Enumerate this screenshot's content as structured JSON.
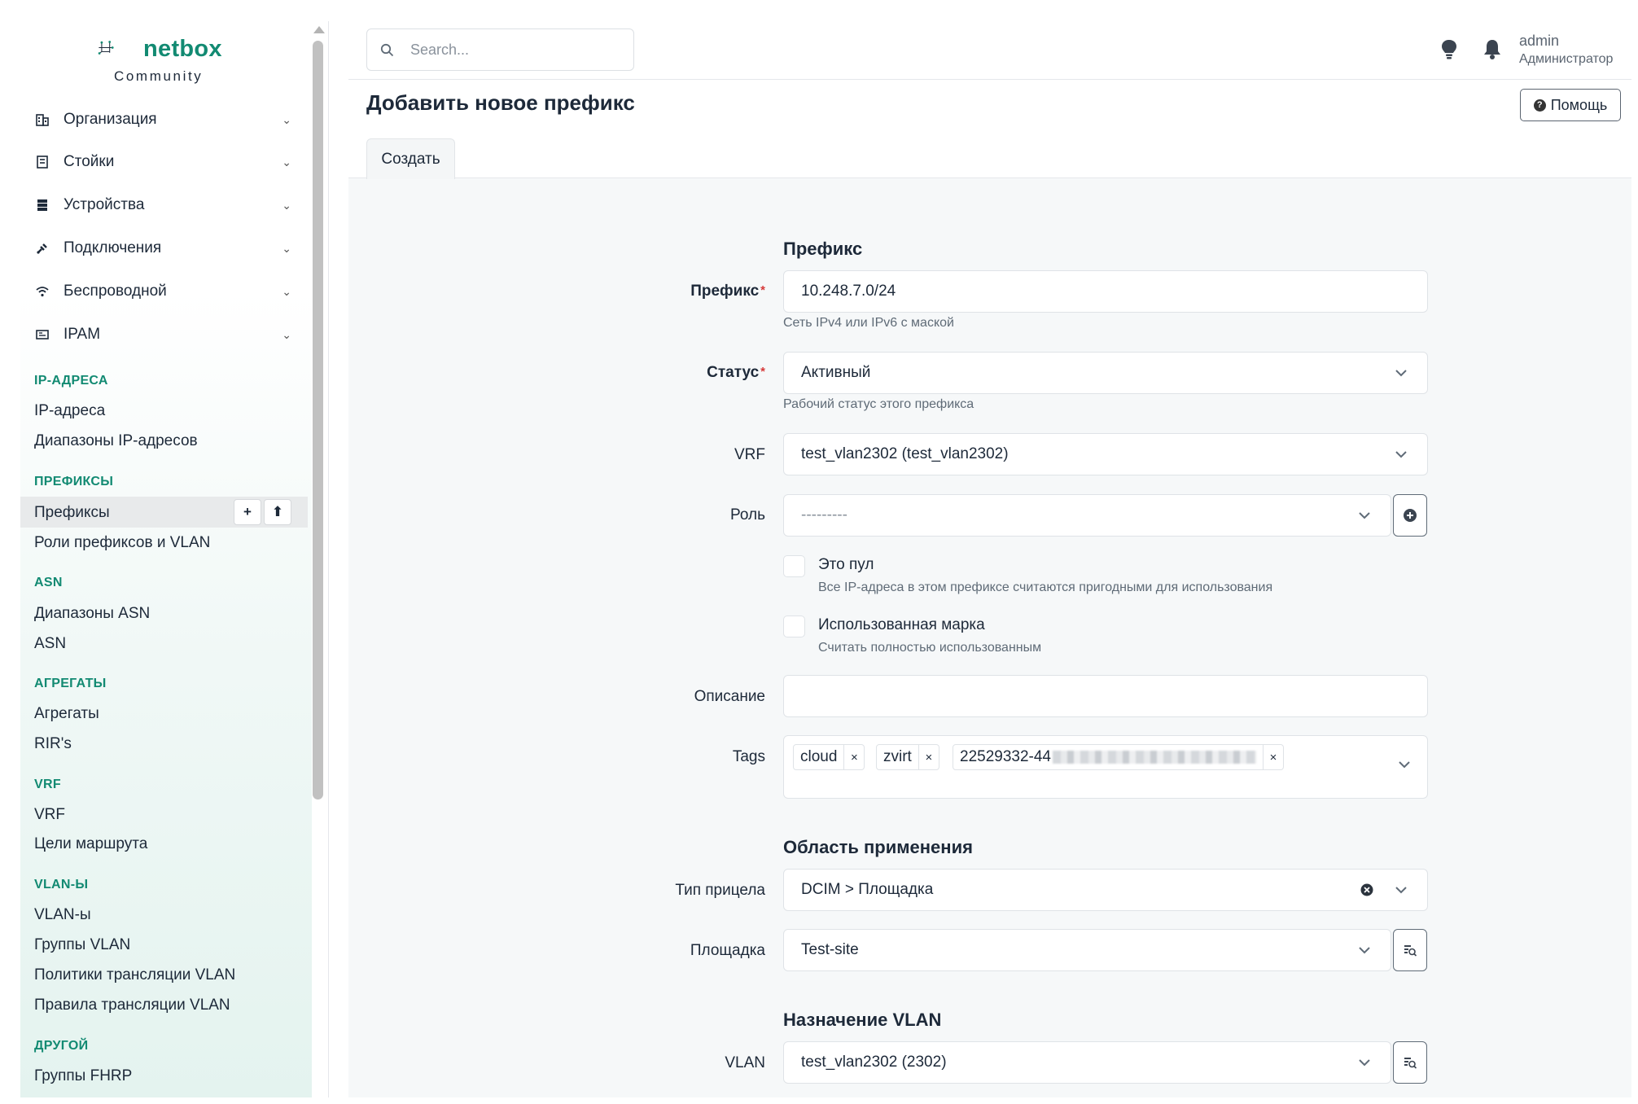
{
  "app": {
    "logo_text": "netbox",
    "logo_sub": "Community"
  },
  "sidebar": {
    "menu": [
      {
        "label": "Организация",
        "icon": "building-icon"
      },
      {
        "label": "Стойки",
        "icon": "rack-icon"
      },
      {
        "label": "Устройства",
        "icon": "server-icon"
      },
      {
        "label": "Подключения",
        "icon": "plug-icon"
      },
      {
        "label": "Беспроводной",
        "icon": "wifi-icon"
      },
      {
        "label": "IPAM",
        "icon": "ipam-icon"
      }
    ],
    "sections": [
      {
        "title": "IP-АДРЕСА",
        "items": [
          "IP-адреса",
          "Диапазоны IP-адресов"
        ]
      },
      {
        "title": "ПРЕФИКСЫ",
        "items": [
          "Префиксы",
          "Роли префиксов и VLAN"
        ]
      },
      {
        "title": "ASN",
        "items": [
          "Диапазоны ASN",
          "ASN"
        ]
      },
      {
        "title": "АГРЕГАТЫ",
        "items": [
          "Агрегаты",
          "RIR's"
        ]
      },
      {
        "title": "VRF",
        "items": [
          "VRF",
          "Цели маршрута"
        ]
      },
      {
        "title": "VLAN-Ы",
        "items": [
          "VLAN-ы",
          "Группы VLAN",
          "Политики трансляции VLAN",
          "Правила трансляции VLAN"
        ]
      },
      {
        "title": "ДРУГОЙ",
        "items": [
          "Группы FHRP"
        ]
      }
    ],
    "active_item": "Префиксы",
    "active_add_label": "+",
    "active_import_label": "⬆"
  },
  "topbar": {
    "search_placeholder": "Search...",
    "user_name": "admin",
    "user_role": "Администратор"
  },
  "page": {
    "title": "Добавить новое префикс",
    "help_label": "Помощь",
    "tab_create": "Создать"
  },
  "form": {
    "group_prefix": "Префикс",
    "prefix_label": "Префикс",
    "prefix_value": "10.248.7.0/24",
    "prefix_hint": "Сеть IPv4 или IPv6 с маской",
    "status_label": "Статус",
    "status_value": "Активный",
    "status_hint": "Рабочий статус этого префикса",
    "vrf_label": "VRF",
    "vrf_value": "test_vlan2302 (test_vlan2302)",
    "role_label": "Роль",
    "role_value": "---------",
    "is_pool_label": "Это пул",
    "is_pool_hint": "Все IP-адреса в этом префиксе считаются пригодными для использования",
    "mark_utilized_label": "Использованная марка",
    "mark_utilized_hint": "Считать полностью использованным",
    "description_label": "Описание",
    "description_value": "",
    "tags_label": "Tags",
    "tags": [
      "cloud",
      "zvirt",
      "22529332-44"
    ],
    "tag_remove_symbol": "×",
    "group_scope": "Область применения",
    "scope_type_label": "Тип прицела",
    "scope_type_value": "DCIM > Площадка",
    "site_label": "Площадка",
    "site_value": "Test-site",
    "group_vlan": "Назначение VLAN",
    "vlan_label": "VLAN",
    "vlan_value": "test_vlan2302 (2302)",
    "required_mark": "*"
  },
  "colors": {
    "brand": "#128a72",
    "required": "#d63939"
  }
}
